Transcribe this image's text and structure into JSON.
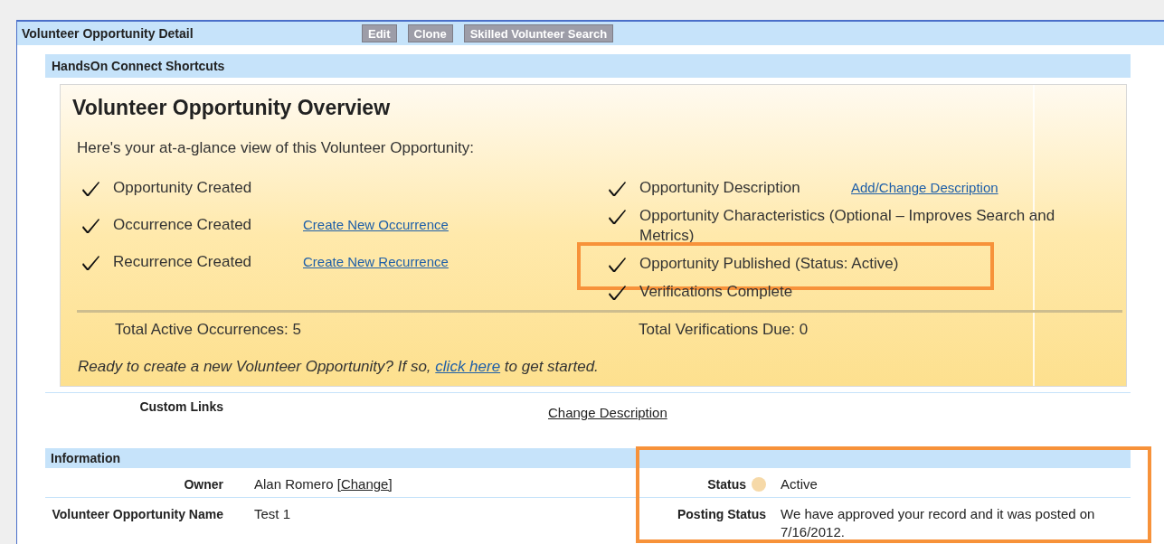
{
  "detail_header": {
    "title": "Volunteer Opportunity Detail",
    "buttons": [
      "Edit",
      "Clone",
      "Skilled Volunteer Search"
    ]
  },
  "shortcuts": {
    "title": "HandsOn Connect Shortcuts",
    "overview": {
      "title": "Volunteer Opportunity Overview",
      "intro": "Here's your at-a-glance view of this Volunteer Opportunity:",
      "left_items": [
        {
          "label": "Opportunity Created",
          "checked": true
        },
        {
          "label": "Occurrence Created",
          "checked": true,
          "link": "Create New Occurrence"
        },
        {
          "label": "Recurrence Created",
          "checked": true,
          "link": "Create New Recurrence"
        }
      ],
      "right_items": [
        {
          "label": "Opportunity Description",
          "checked": true,
          "highlighted": false,
          "link": "Add/Change Description"
        },
        {
          "label": "Opportunity Characteristics (Optional – Improves Search and Metrics)",
          "checked": true,
          "highlighted": false
        },
        {
          "label": "Opportunity Published (Status: Active)",
          "checked": true,
          "highlighted": true
        },
        {
          "label": "Verifications Complete",
          "checked": true,
          "highlighted": false
        }
      ],
      "total_left": "Total Active Occurrences: 5",
      "total_right": "Total Verifications Due: 0",
      "prompt_before": "Ready to create a new Volunteer Opportunity? If so,",
      "prompt_link": "click here",
      "prompt_after": "to get started."
    }
  },
  "custom_links": {
    "label": "Custom Links",
    "link": "Change Description"
  },
  "information": {
    "title": "Information",
    "right_highlighted": true,
    "left_fields": [
      {
        "label": "Owner",
        "value": "Alan Romero",
        "link": "[Change]"
      },
      {
        "label": "Volunteer Opportunity Name",
        "value": "Test 1"
      }
    ],
    "right_fields": [
      {
        "label": "Status",
        "value": "Active",
        "help": true
      },
      {
        "label": "Posting Status",
        "value": "We have approved your record and it was posted on 7/16/2012."
      }
    ]
  }
}
